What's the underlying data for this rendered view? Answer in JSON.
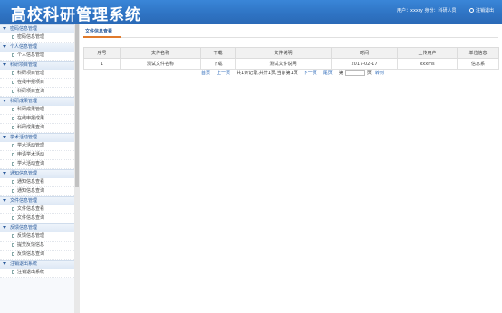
{
  "header": {
    "title": "高校科研管理系统",
    "user_info": "用户：xxxry 身份：科研人员",
    "logout": "注销退出"
  },
  "sidebar": {
    "groups": [
      {
        "label": "密码信息管理",
        "items": [
          "密码信息管理"
        ]
      },
      {
        "label": "个人信息管理",
        "items": [
          "个人信息管理"
        ]
      },
      {
        "label": "科研项目管理",
        "items": [
          "科研项目管理",
          "在线申报项目",
          "科研项目查询"
        ]
      },
      {
        "label": "科研成果管理",
        "items": [
          "科研成果管理",
          "在线申报成果",
          "科研成果查询"
        ]
      },
      {
        "label": "学术活动管理",
        "items": [
          "学术活动管理",
          "申请学术活动",
          "学术活动查询"
        ]
      },
      {
        "label": "通知信息管理",
        "items": [
          "通知信息查看",
          "通知信息查询"
        ]
      },
      {
        "label": "文件信息管理",
        "items": [
          "文件信息查看",
          "文件信息查询"
        ]
      },
      {
        "label": "反馈信息管理",
        "items": [
          "反馈信息管理",
          "提交反馈信息",
          "反馈信息查询"
        ]
      },
      {
        "label": "注销退出系统",
        "items": [
          "注销退出系统"
        ]
      }
    ]
  },
  "main": {
    "tab": "文件信息查看",
    "table": {
      "headers": [
        "序号",
        "文件名称",
        "下载",
        "文件说明",
        "时间",
        "上传用户",
        "单位信息"
      ],
      "rows": [
        [
          "1",
          "测试文件名称",
          "下载",
          "测试文件说明",
          "2017-02-17",
          "xxxms",
          "信息系"
        ]
      ]
    },
    "pager": {
      "first": "首页",
      "prev": "上一页",
      "summary": "共1条记录,共计1页,当前第1页",
      "next": "下一页",
      "last": "尾页",
      "page_prefix": "第",
      "page_suffix": "页",
      "goto": "转到",
      "page_input": ""
    }
  }
}
